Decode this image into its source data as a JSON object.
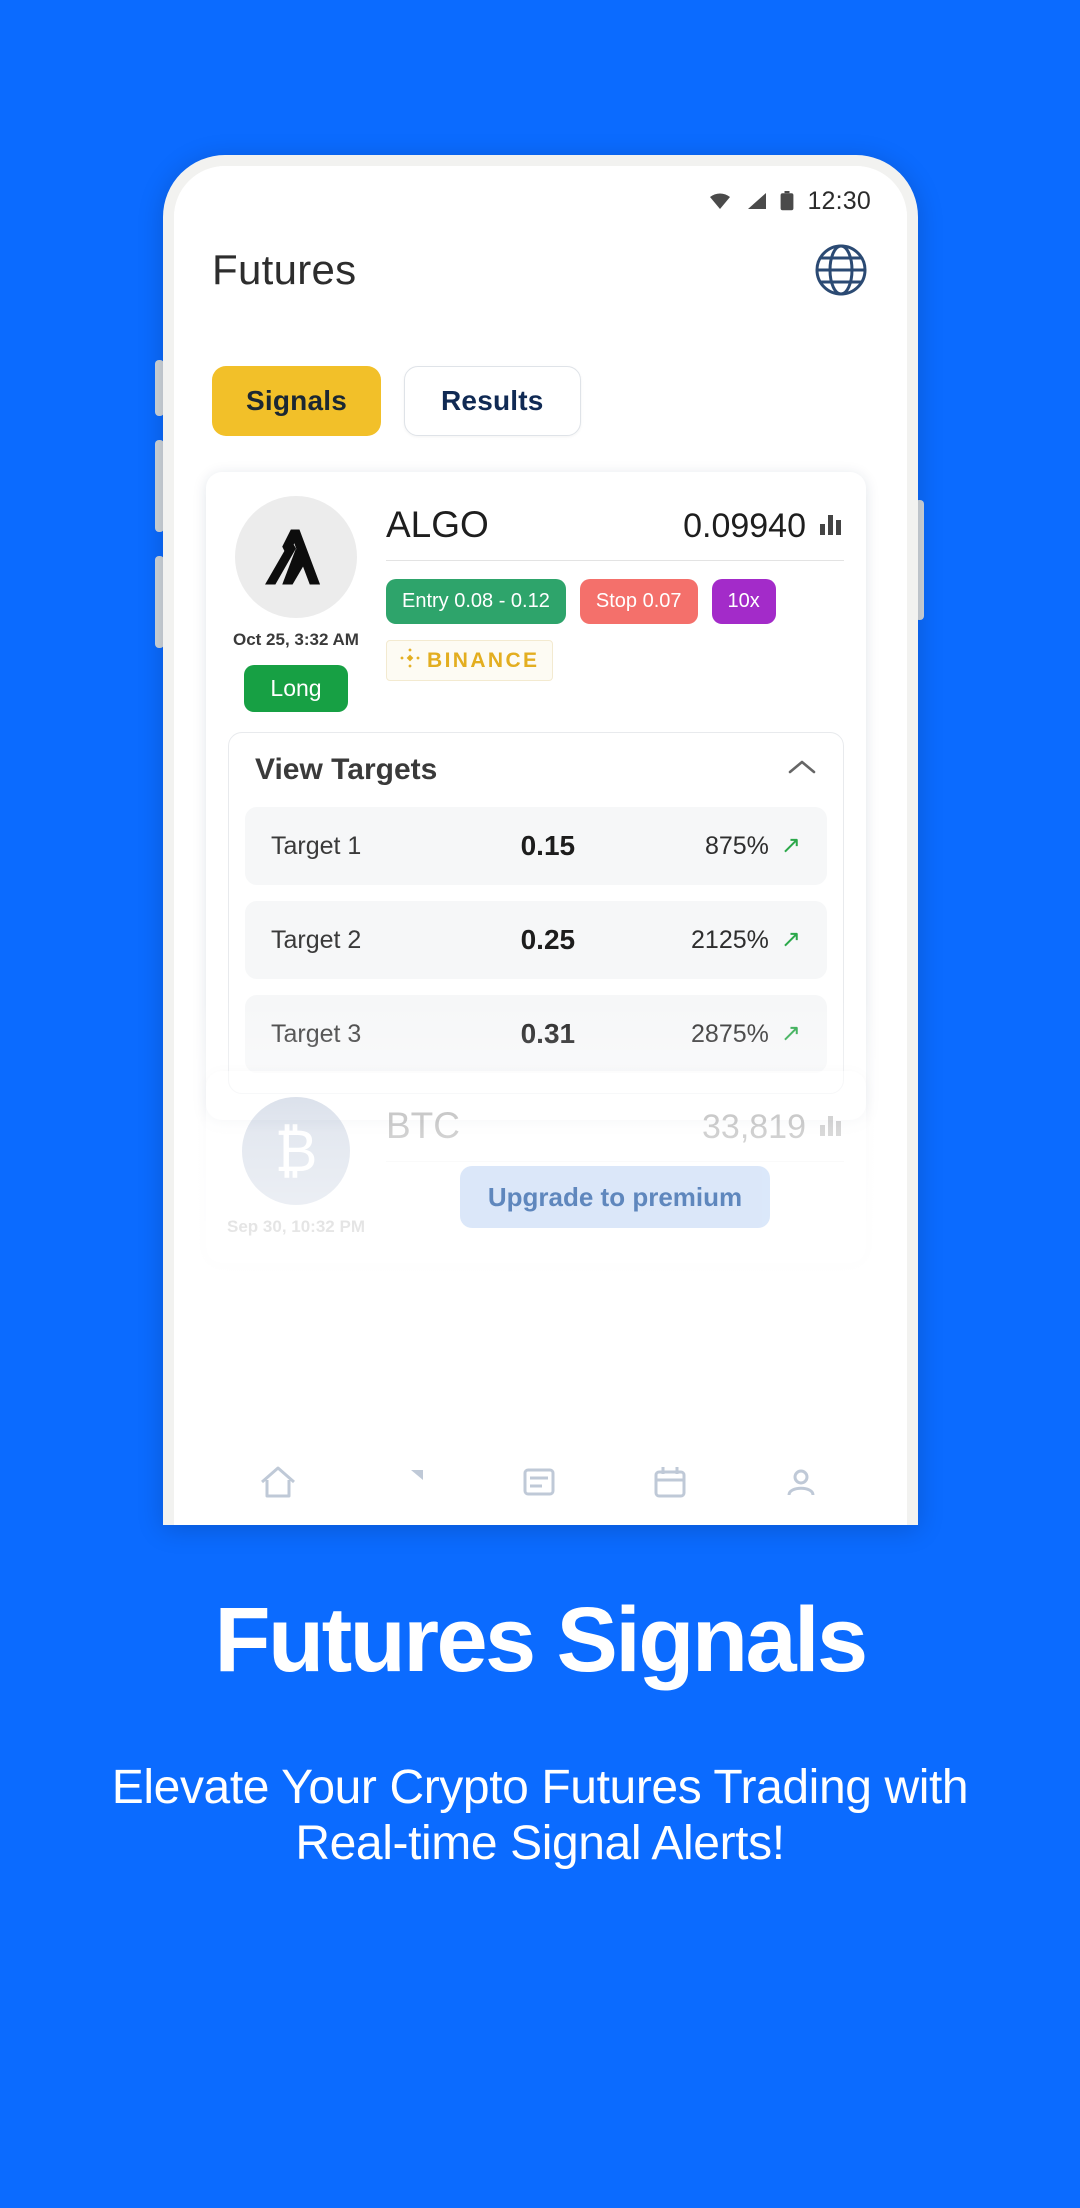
{
  "background_color": "#0B6BFF",
  "statusbar": {
    "time": "12:30",
    "icons": [
      "wifi-icon",
      "signal-icon",
      "battery-icon"
    ]
  },
  "header": {
    "title": "Futures",
    "globe_icon": "globe-icon"
  },
  "tabs": [
    {
      "label": "Signals",
      "active": true
    },
    {
      "label": "Results",
      "active": false
    }
  ],
  "signal_card": {
    "coin_logo": "algorand-logo-icon",
    "symbol": "ALGO",
    "price": "0.09940",
    "chart_icon": "bar-chart-icon",
    "date": "Oct 25, 3:32 AM",
    "side": "Long",
    "badges": {
      "entry": "Entry 0.08 - 0.12",
      "stop": "Stop 0.07",
      "leverage": "10x"
    },
    "exchange": {
      "name": "BINANCE",
      "icon": "binance-logo-icon"
    },
    "targets_panel": {
      "title": "View Targets",
      "collapse_icon": "chevron-up-icon",
      "rows": [
        {
          "name": "Target 1",
          "value": "0.15",
          "percent": "875%",
          "trend": "up-right-arrow-icon"
        },
        {
          "name": "Target 2",
          "value": "0.25",
          "percent": "2125%",
          "trend": "up-right-arrow-icon"
        },
        {
          "name": "Target 3",
          "value": "0.31",
          "percent": "2875%",
          "trend": "up-right-arrow-icon"
        }
      ]
    }
  },
  "signal_card_2": {
    "coin_logo": "bitcoin-logo-icon",
    "symbol": "BTC",
    "price": "33,819",
    "chart_icon": "bar-chart-icon",
    "date": "Sep 30, 10:32 PM"
  },
  "upgrade_button": {
    "label": "Upgrade to premium"
  },
  "bottom_nav": [
    "home-icon",
    "signals-icon",
    "news-icon",
    "calendar-icon",
    "profile-icon"
  ],
  "marketing": {
    "headline": "Futures Signals",
    "subhead": "Elevate Your Crypto Futures Trading with Real-time Signal Alerts!"
  },
  "colors": {
    "brand_blue": "#0B6BFF",
    "accent_yellow": "#F2C029",
    "green": "#17A044",
    "entry_green": "#2EA46B",
    "stop_red": "#F4706B",
    "leverage_purple": "#A32BC9",
    "binance_gold": "#E3AE20"
  }
}
